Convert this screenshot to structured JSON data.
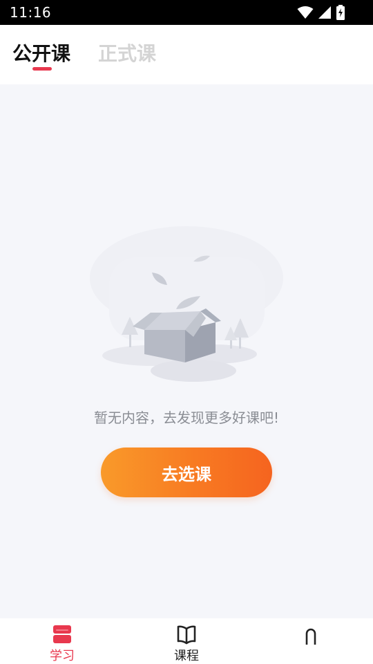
{
  "status_bar": {
    "time": "11:16",
    "icons": [
      "wifi-icon",
      "signal-icon",
      "battery-icon"
    ]
  },
  "tabs": [
    {
      "label": "公开课",
      "active": true
    },
    {
      "label": "正式课",
      "active": false
    }
  ],
  "empty_state": {
    "message": "暂无内容，去发现更多好课吧!",
    "button_label": "去选课"
  },
  "bottom_nav": [
    {
      "label": "学习",
      "icon": "study-icon",
      "active": true
    },
    {
      "label": "课程",
      "icon": "book-icon",
      "active": false
    },
    {
      "label": "",
      "icon": "profile-icon",
      "active": false
    }
  ],
  "colors": {
    "accent": "#e8384e",
    "button_start": "#f99a2a",
    "button_end": "#f5641f",
    "background": "#f5f6fa"
  }
}
